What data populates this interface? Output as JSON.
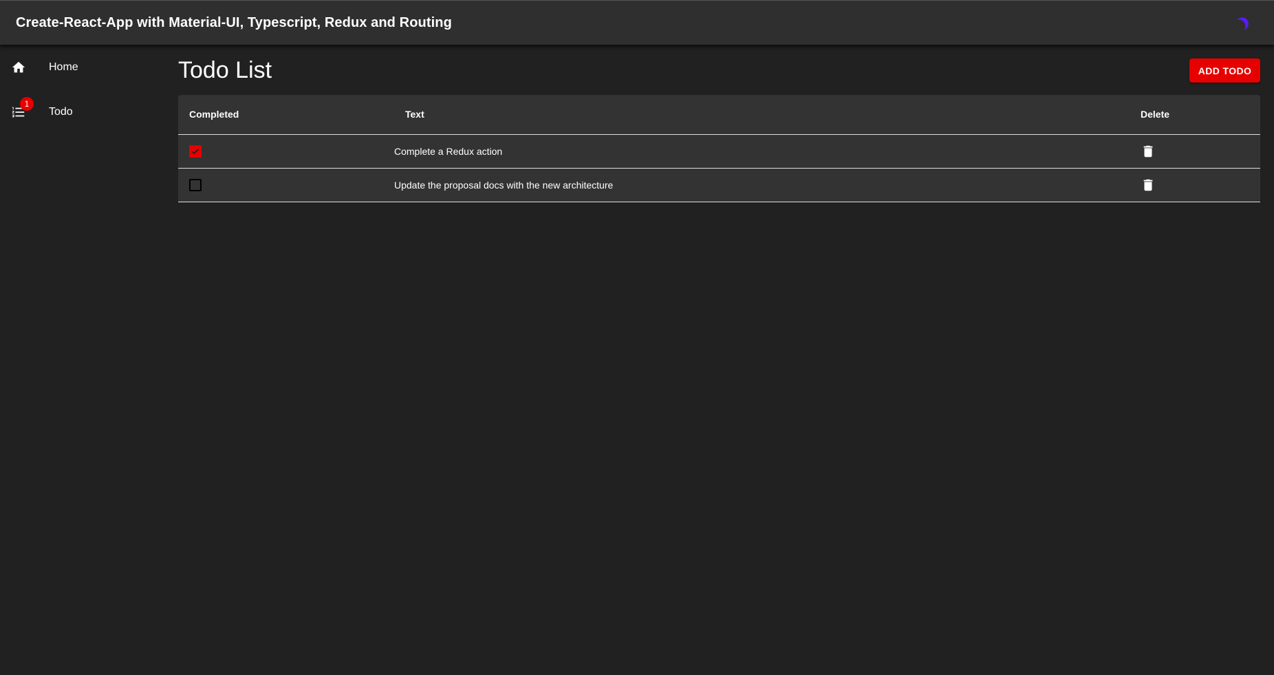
{
  "app": {
    "title": "Create-React-App with Material-UI, Typescript, Redux and Routing",
    "theme_toggle_icon": "moon-icon"
  },
  "sidebar": {
    "items": [
      {
        "label": "Home",
        "icon": "home-icon"
      },
      {
        "label": "Todo",
        "icon": "list-icon",
        "badge": "1"
      }
    ]
  },
  "main": {
    "title": "Todo List",
    "add_button_label": "ADD TODO"
  },
  "table": {
    "headers": [
      "Completed",
      "Text",
      "Delete"
    ],
    "rows": [
      {
        "completed": true,
        "text": "Complete a Redux action"
      },
      {
        "completed": false,
        "text": "Update the proposal docs with the new architecture"
      }
    ]
  },
  "colors": {
    "accent": "#e60000",
    "appbar": "#2f2f2f",
    "background": "#212121",
    "table": "#333333",
    "toggle": "#5a1aff"
  }
}
